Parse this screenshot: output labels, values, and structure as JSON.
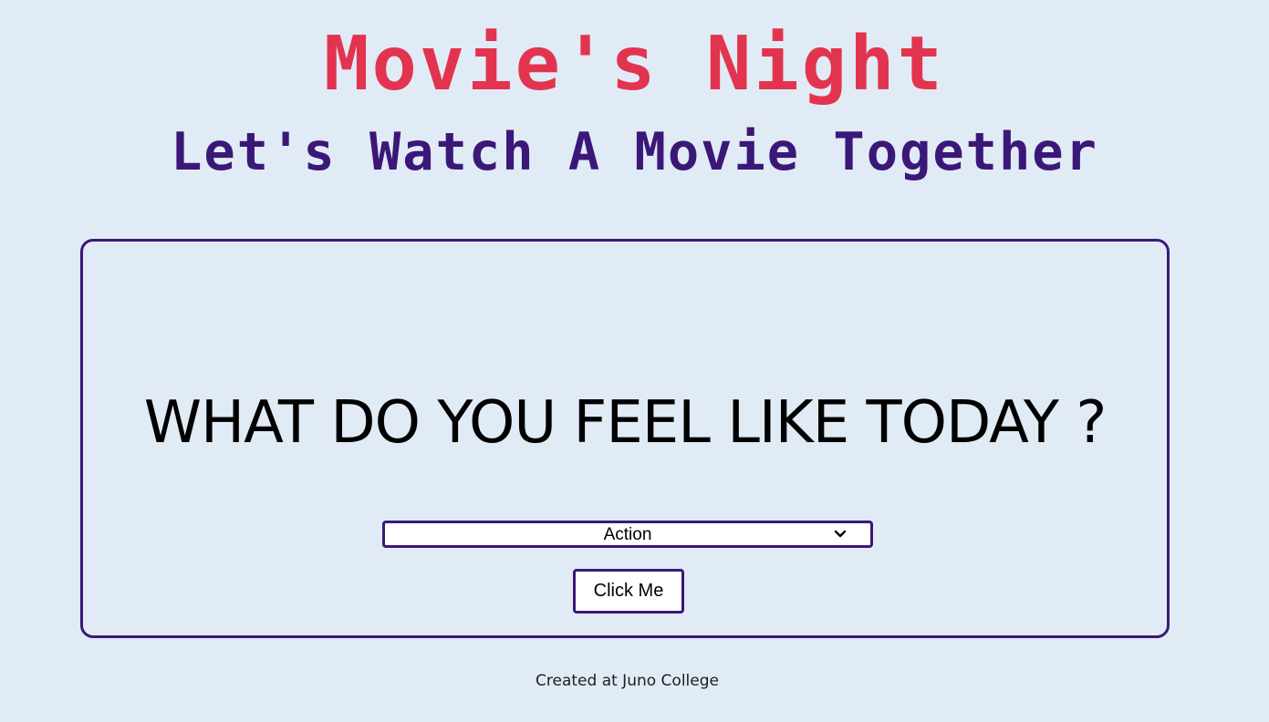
{
  "header": {
    "title": "Movie's Night",
    "subtitle": "Let's Watch A Movie Together"
  },
  "main": {
    "question": "WHAT DO YOU FEEL LIKE TODAY ?",
    "genre_select": {
      "selected": "Action",
      "icon": "chevron-down-icon"
    },
    "submit_label": "Click Me"
  },
  "footer": {
    "text": "Created at Juno College"
  },
  "colors": {
    "background": "#e1ebf6",
    "title": "#e2344f",
    "accent": "#3b1877"
  }
}
